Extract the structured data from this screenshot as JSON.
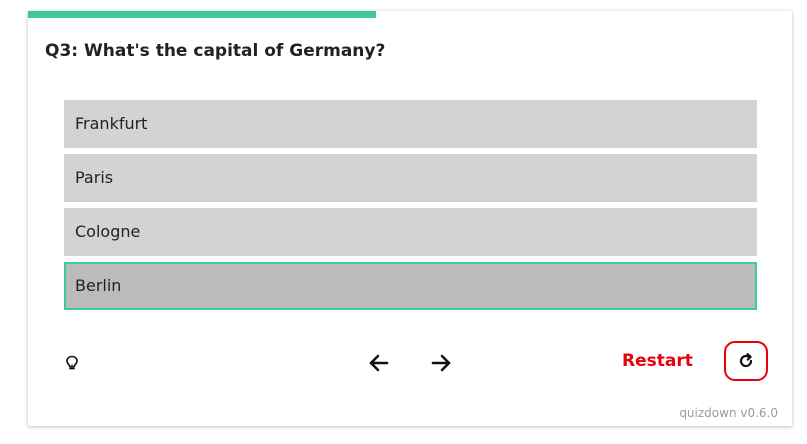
{
  "quiz": {
    "progress": 0.455,
    "progress_color": "#3ec99a",
    "question": "Q3: What's the capital of Germany?",
    "options": [
      {
        "label": "Frankfurt",
        "selected": false
      },
      {
        "label": "Paris",
        "selected": false
      },
      {
        "label": "Cologne",
        "selected": false
      },
      {
        "label": "Berlin",
        "selected": true
      }
    ]
  },
  "controls": {
    "hint_icon": "lightbulb-icon",
    "prev_icon": "arrow-left-icon",
    "next_icon": "arrow-right-icon",
    "restart_label": "Restart",
    "reload_icon": "reload-icon",
    "accent_color": "#e8000b"
  },
  "footer": {
    "version": "quizdown v0.6.0"
  }
}
